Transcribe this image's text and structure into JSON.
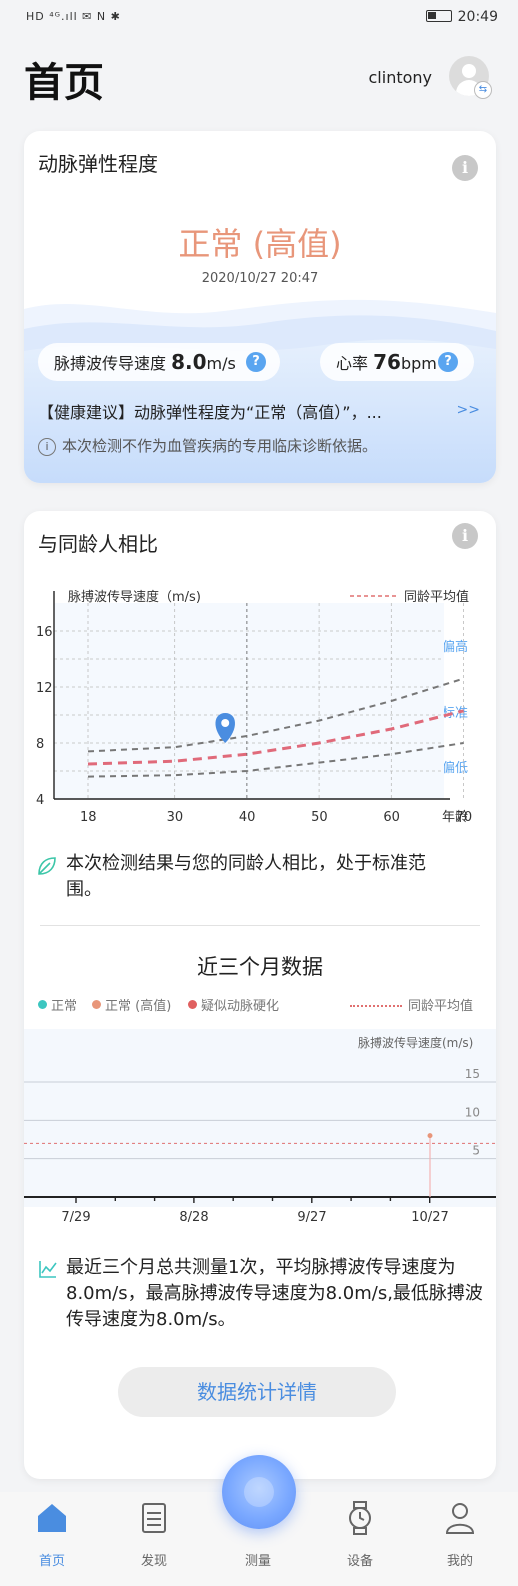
{
  "status_bar": {
    "left": "HD ⁴ᴳ.ıll ✉ N ✱",
    "time": "20:49",
    "battery": "▭"
  },
  "header": {
    "title": "首页",
    "username": "clintony"
  },
  "elasticity_card": {
    "title": "动脉弹性程度",
    "result": "正常 (高值)",
    "timestamp": "2020/10/27 20:47",
    "pwv_label": "脉搏波传导速度",
    "pwv_value": "8.0",
    "pwv_unit": "m/s",
    "hr_label": "心率",
    "hr_value": "76",
    "hr_unit": "bpm",
    "advice": "【健康建议】动脉弹性程度为“正常（高值）”，...",
    "more": ">>",
    "disclaimer": "本次检测不作为血管疾病的专用临床诊断依据。"
  },
  "compare_card": {
    "title": "与同龄人相比",
    "chart_ylabel": "脉搏波传导速度（m/s)",
    "chart_legend": "同龄平均值",
    "zone_high": "偏高",
    "zone_normal": "标准",
    "zone_low": "偏低",
    "xlabel": "年龄",
    "result_text": "本次检测结果与您的同龄人相比，处于标准范围。"
  },
  "recent_section": {
    "title": "近三个月数据",
    "legend": {
      "normal": "正常",
      "normal_high": "正常 (高值)",
      "suspected": "疑似动脉硬化",
      "avg": "同龄平均值"
    },
    "chart_ylabel": "脉搏波传导速度(m/s)",
    "summary": "最近三个月总共测量1次，平均脉搏波传导速度为8.0m/s，最高脉搏波传导速度为8.0m/s,最低脉搏波传导速度为8.0m/s。",
    "stats_button": "数据统计详情"
  },
  "nav": {
    "home": "首页",
    "discover": "发现",
    "measure": "测量",
    "device": "设备",
    "me": "我的"
  },
  "colors": {
    "accent": "#4a8de0",
    "normal_high": "#e8967a",
    "normal": "#3cc6c0",
    "suspected": "#e06060",
    "avg_line": "#e07070"
  },
  "chart_data": [
    {
      "type": "line",
      "title": "",
      "xlabel": "年龄",
      "ylabel": "脉搏波传导速度（m/s)",
      "x": [
        18,
        30,
        40,
        50,
        60,
        70
      ],
      "ylim": [
        4,
        18
      ],
      "xlim": [
        18,
        72
      ],
      "yticks": [
        4,
        8,
        12,
        16
      ],
      "series": [
        {
          "name": "同龄平均值",
          "style": "dashed-red",
          "values": [
            6.5,
            6.7,
            7.2,
            8.0,
            9.0,
            10.3
          ]
        },
        {
          "style": "dashed-gray",
          "values": [
            7.4,
            7.7,
            8.5,
            9.6,
            11.0,
            12.6
          ]
        },
        {
          "style": "dashed-gray",
          "values": [
            5.6,
            5.7,
            6.0,
            6.6,
            7.2,
            8.0
          ]
        }
      ],
      "point": {
        "x": 37,
        "y": 8.0
      },
      "zone_labels": [
        "偏高",
        "标准",
        "偏低"
      ],
      "grid": true
    },
    {
      "type": "scatter",
      "title": "",
      "ylabel": "脉搏波传导速度(m/s)",
      "categories": [
        "7/29",
        "8/28",
        "9/27",
        "10/27"
      ],
      "yticks": [
        5,
        10,
        15
      ],
      "ylim": [
        0,
        18
      ],
      "points": [
        {
          "x": "10/27",
          "y": 8.0
        }
      ],
      "avg_line": 7,
      "grid": true
    }
  ]
}
